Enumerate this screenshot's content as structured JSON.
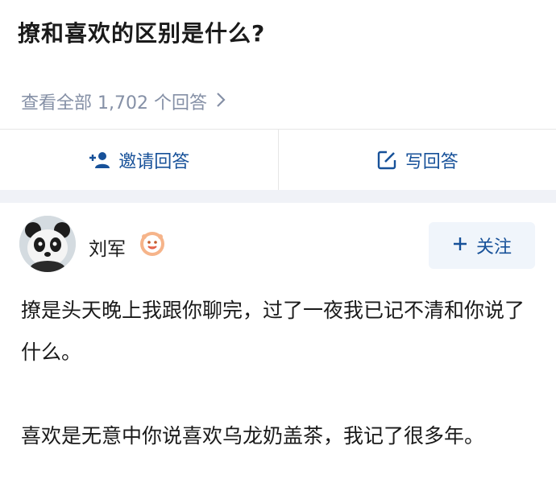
{
  "question": {
    "title": "撩和喜欢的区别是什么?",
    "view_all_label": "查看全部 1,702 个回答"
  },
  "actions": {
    "invite_label": "邀请回答",
    "write_label": "写回答"
  },
  "author": {
    "name": "刘军",
    "follow_label": "关注"
  },
  "answer": {
    "paragraph_1": "撩是头天晚上我跟你聊完，过了一夜我已记不清和你说了什么。",
    "paragraph_2": "喜欢是无意中你说喜欢乌龙奶盖茶，我记了很多年。"
  },
  "colors": {
    "link_blue": "#175199",
    "muted_gray": "#8590a6",
    "follow_bg": "#f0f5fb",
    "divider_bg": "#f0f2f7"
  }
}
